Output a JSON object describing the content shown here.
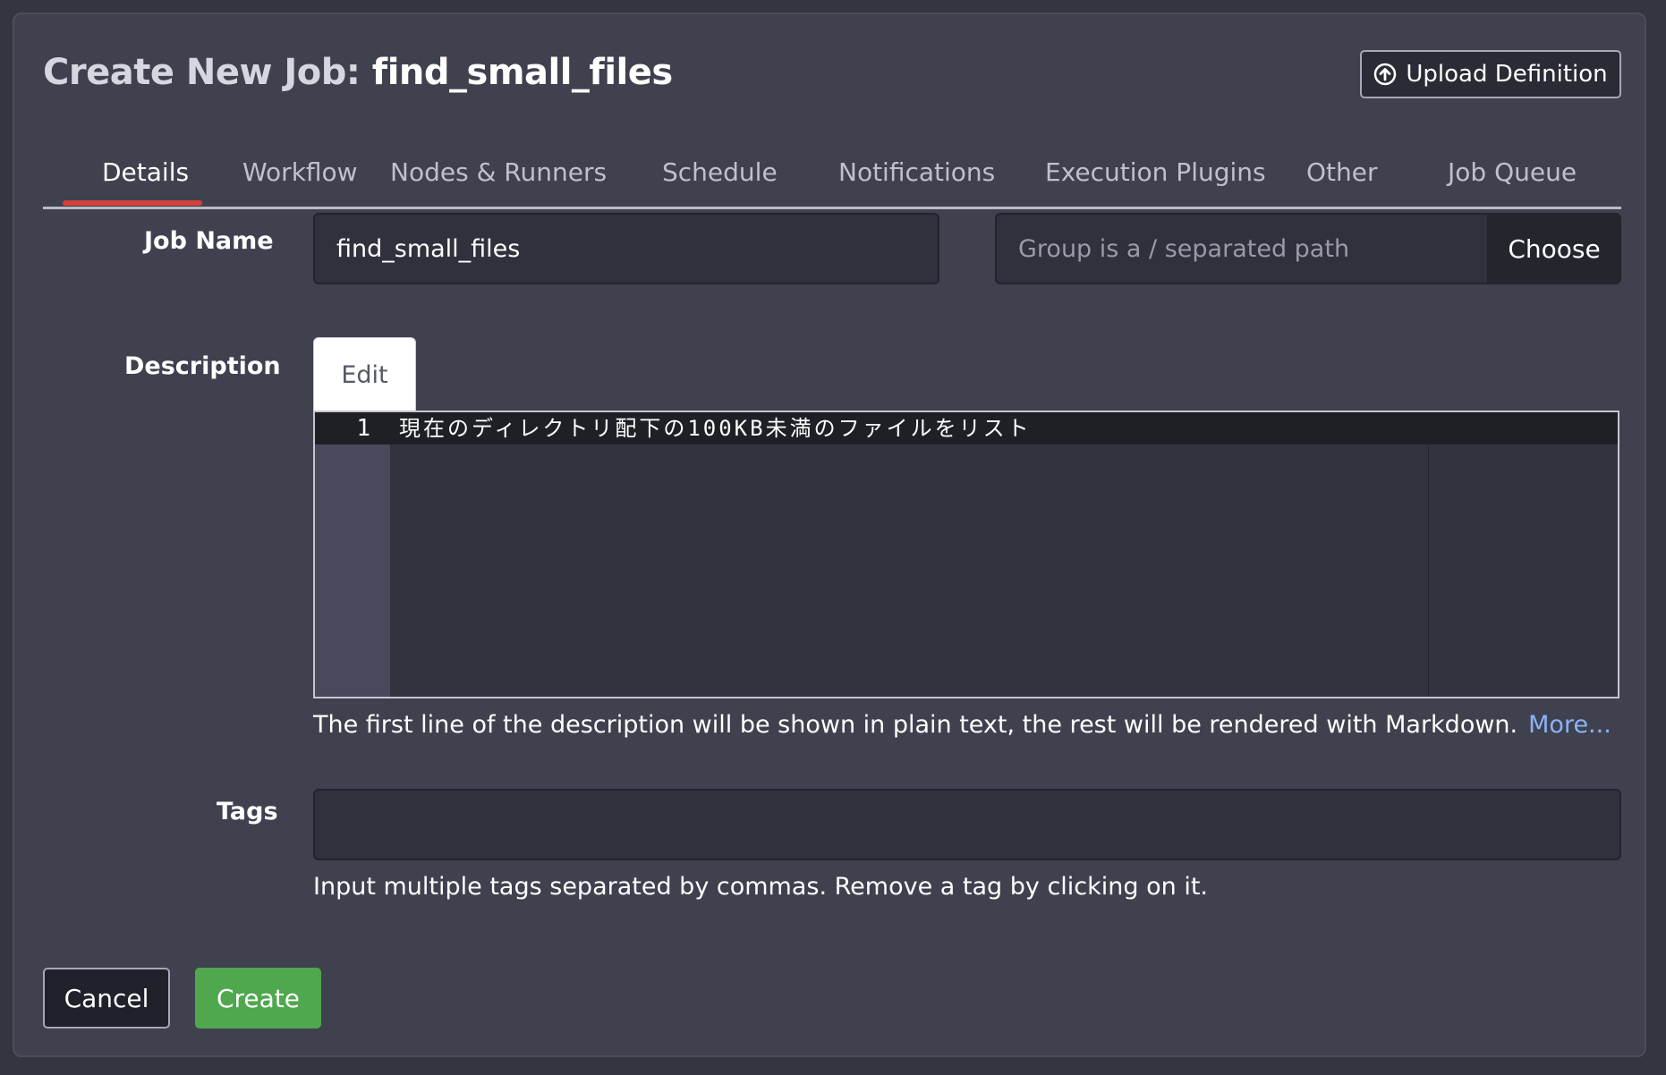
{
  "header": {
    "title_prefix": "Create New Job:",
    "job_name": "find_small_files",
    "upload_label": "Upload Definition",
    "upload_icon": "arrow-up-circle-icon"
  },
  "tabs": [
    {
      "label": "Details",
      "active": true
    },
    {
      "label": "Workflow",
      "active": false
    },
    {
      "label": "Nodes & Runners",
      "active": false
    },
    {
      "label": "Schedule",
      "active": false
    },
    {
      "label": "Notifications",
      "active": false
    },
    {
      "label": "Execution Plugins",
      "active": false
    },
    {
      "label": "Other",
      "active": false
    },
    {
      "label": "Job Queue",
      "active": false
    }
  ],
  "form": {
    "job_name_label": "Job Name",
    "job_name_value": "find_small_files",
    "group_placeholder": "Group is a / separated path",
    "group_value": "",
    "choose_label": "Choose",
    "description_label": "Description",
    "edit_tab_label": "Edit",
    "editor": {
      "line_number": "1",
      "line_text": "現在のディレクトリ配下の100KB未満のファイルをリスト"
    },
    "description_help": "The first line of the description will be shown in plain text, the rest will be rendered with Markdown.",
    "more_link": "More...",
    "tags_label": "Tags",
    "tags_value": "",
    "tags_help": "Input multiple tags separated by commas. Remove a tag by clicking on it."
  },
  "footer": {
    "cancel_label": "Cancel",
    "create_label": "Create"
  },
  "colors": {
    "accent_tab": "#d2413b",
    "create_button": "#4fa84d",
    "link": "#8ab4f8",
    "panel": "#40414f"
  }
}
